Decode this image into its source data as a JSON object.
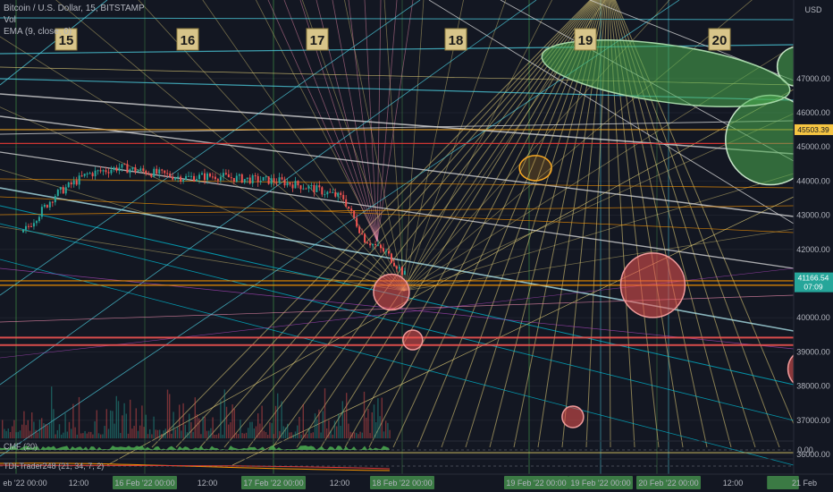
{
  "header": {
    "title": "Bitcoin / U.S. Dollar, 15, BITSTAMP",
    "volume_label": "Vol",
    "ema_label": "EMA (9, close, 0)",
    "currency": "USD"
  },
  "indicators": {
    "cmf_label": "CMF (20)",
    "cmf_value": "0.00",
    "trader_label": "TDI-Trader248 (21, 34, 7, 2)"
  },
  "price_badges": {
    "level": "45503.39",
    "current": "41166.54",
    "countdown": "07:09"
  },
  "chart_data": {
    "type": "candlestick",
    "title": "Bitcoin / U.S. Dollar, 15, BITSTAMP",
    "y_axis": {
      "unit": "USD",
      "ticks": [
        36000,
        37000,
        38000,
        39000,
        40000,
        41000,
        42000,
        43000,
        44000,
        45000,
        46000,
        47000
      ],
      "tick_labels": [
        "36000.00",
        "37000.00",
        "38000.00",
        "39000.00",
        "40000.00",
        "41000.00",
        "42000.00",
        "43000.00",
        "44000.00",
        "45000.00",
        "46000.00",
        "47000.00"
      ],
      "range": [
        35850,
        47800
      ]
    },
    "x_axis": {
      "tick_labels": [
        "eb '22  00:00",
        "12:00",
        "16 Feb '22  00:00",
        "12:00",
        "17 Feb '22  00:00",
        "12:00",
        "18 Feb '22  00:00",
        "19 Feb '22  00:00",
        "19 Feb '22  00:00",
        "20 Feb '22  00:00",
        "12:00",
        "21 Feb"
      ],
      "highlighted": [
        false,
        false,
        true,
        false,
        true,
        false,
        true,
        true,
        true,
        true,
        false,
        true
      ]
    },
    "day_boxes": [
      "15",
      "16",
      "17",
      "18",
      "19",
      "20"
    ],
    "price_path": {
      "time_hours": [
        0,
        6,
        12,
        18,
        24,
        30,
        36,
        42,
        48,
        54,
        60,
        64,
        68,
        72
      ],
      "close": [
        42500,
        43600,
        44200,
        44400,
        44250,
        44100,
        44150,
        44050,
        44000,
        43800,
        43500,
        42300,
        41900,
        41170
      ]
    },
    "horizontal_levels": [
      {
        "price": 45503.39,
        "color": "#f5a623"
      },
      {
        "price": 45100,
        "color": "#e53935"
      },
      {
        "price": 41080,
        "color": "#ff9800"
      },
      {
        "price": 40950,
        "color": "#ff9800"
      },
      {
        "price": 39420,
        "color": "#ef5350"
      },
      {
        "price": 39200,
        "color": "#ef5350"
      },
      {
        "price": 36050,
        "color": "#c8b560"
      }
    ],
    "circles": [
      {
        "time_h": 69,
        "price": 40750,
        "color": "#ef5350"
      },
      {
        "time_h": 73,
        "price": 39350,
        "color": "#ef5350"
      },
      {
        "time_h": 96,
        "price": 44380,
        "color": "#f5a623"
      },
      {
        "time_h": 118,
        "price": 40950,
        "color": "#ef5350"
      },
      {
        "time_h": 103,
        "price": 37100,
        "color": "#ef5350"
      },
      {
        "time_h": 147,
        "price": 38500,
        "color": "#ef5350"
      },
      {
        "time_h": 140,
        "price": 45200,
        "color": "#4caf50"
      },
      {
        "time_h": 145,
        "price": 47350,
        "color": "#4caf50"
      },
      {
        "time_h": 128,
        "price": 46050,
        "color": "#4caf50"
      }
    ]
  }
}
